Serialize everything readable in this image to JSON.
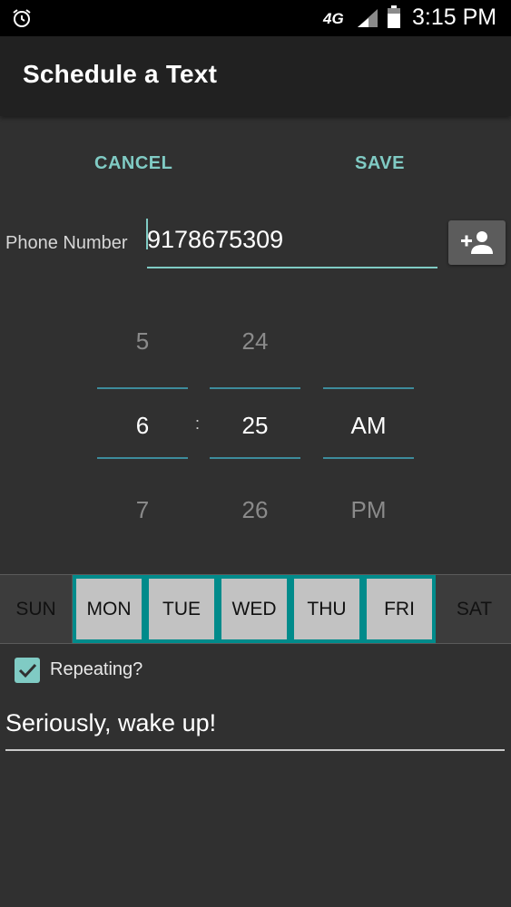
{
  "status_bar": {
    "network": "4G",
    "time": "3:15 PM"
  },
  "toolbar": {
    "title": "Schedule a Text"
  },
  "actions": {
    "cancel_label": "CANCEL",
    "save_label": "SAVE"
  },
  "phone": {
    "label": "Phone Number",
    "value": "9178675309",
    "contact_icon": "add-contact-icon"
  },
  "time_picker": {
    "hour": {
      "prev": "5",
      "selected": "6",
      "next": "7"
    },
    "minute": {
      "prev": "24",
      "selected": "25",
      "next": "26"
    },
    "period": {
      "prev": "",
      "selected": "AM",
      "next": "PM"
    },
    "separator": ":"
  },
  "days": [
    {
      "label": "SUN",
      "selected": false
    },
    {
      "label": "MON",
      "selected": true
    },
    {
      "label": "TUE",
      "selected": true
    },
    {
      "label": "WED",
      "selected": true
    },
    {
      "label": "THU",
      "selected": true
    },
    {
      "label": "FRI",
      "selected": true
    },
    {
      "label": "SAT",
      "selected": false
    }
  ],
  "repeating": {
    "label": "Repeating?",
    "checked": true
  },
  "message": {
    "value": "Seriously, wake up!"
  },
  "colors": {
    "accent": "#80cbc4",
    "day_selected_border": "#008b8b",
    "background": "#303030",
    "toolbar": "#212121"
  }
}
